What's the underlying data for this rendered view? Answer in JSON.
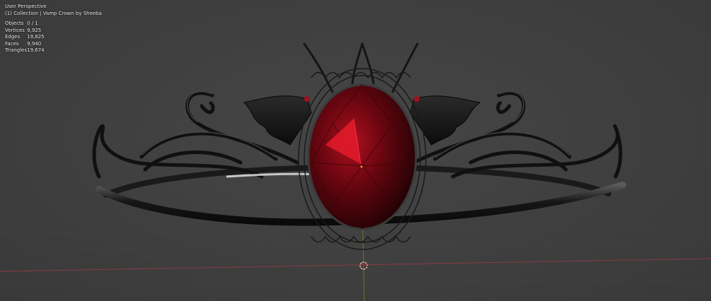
{
  "viewport": {
    "view_name": "User Perspective",
    "collection_line": "(1) Collection | Vamp Crown by Sheeba",
    "stats": [
      {
        "label": "Objects",
        "value": "0 / 1"
      },
      {
        "label": "Vertices",
        "value": "9,925"
      },
      {
        "label": "Edges",
        "value": "19,825"
      },
      {
        "label": "Faces",
        "value": "9,940"
      },
      {
        "label": "Triangles",
        "value": "19,674"
      }
    ]
  },
  "colors": {
    "background": "#3d3d3d",
    "grid": "#4a4a4a",
    "x_axis": "#8c3a44",
    "y_axis": "#5d7a2a",
    "cursor_outer": "#e05050",
    "metal": "#121212",
    "gem": "#8a0a14"
  },
  "object": {
    "name": "Vamp Crown by Sheeba"
  },
  "icons": [
    "3d-cursor-icon",
    "origin-dot-icon"
  ]
}
